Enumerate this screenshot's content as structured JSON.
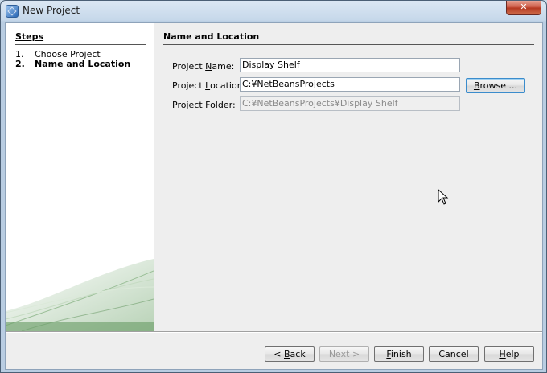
{
  "window": {
    "title": "New Project",
    "close_symbol": "✕"
  },
  "steps": {
    "header": "Steps",
    "items": [
      {
        "num": "1.",
        "label": "Choose Project"
      },
      {
        "num": "2.",
        "label": "Name and Location"
      }
    ]
  },
  "section": {
    "title": "Name and Location"
  },
  "fields": {
    "name": {
      "label_pre": "Project ",
      "label_u": "N",
      "label_post": "ame:",
      "value": "Display Shelf"
    },
    "location": {
      "label_pre": "Project ",
      "label_u": "L",
      "label_post": "ocation:",
      "value": "C:¥NetBeansProjects"
    },
    "folder": {
      "label_pre": "Project ",
      "label_u": "F",
      "label_post": "older:",
      "value": "C:¥NetBeansProjects¥Display Shelf"
    }
  },
  "buttons": {
    "browse": {
      "u": "B",
      "rest": "rowse ..."
    },
    "back": {
      "pre": "< ",
      "u": "B",
      "rest": "ack"
    },
    "next": "Next >",
    "finish": {
      "u": "F",
      "rest": "inish"
    },
    "cancel": "Cancel",
    "help": {
      "u": "H",
      "rest": "elp"
    }
  },
  "icons": {
    "app": "netbeans-cube-icon",
    "cursor": "mouse-pointer-icon"
  }
}
